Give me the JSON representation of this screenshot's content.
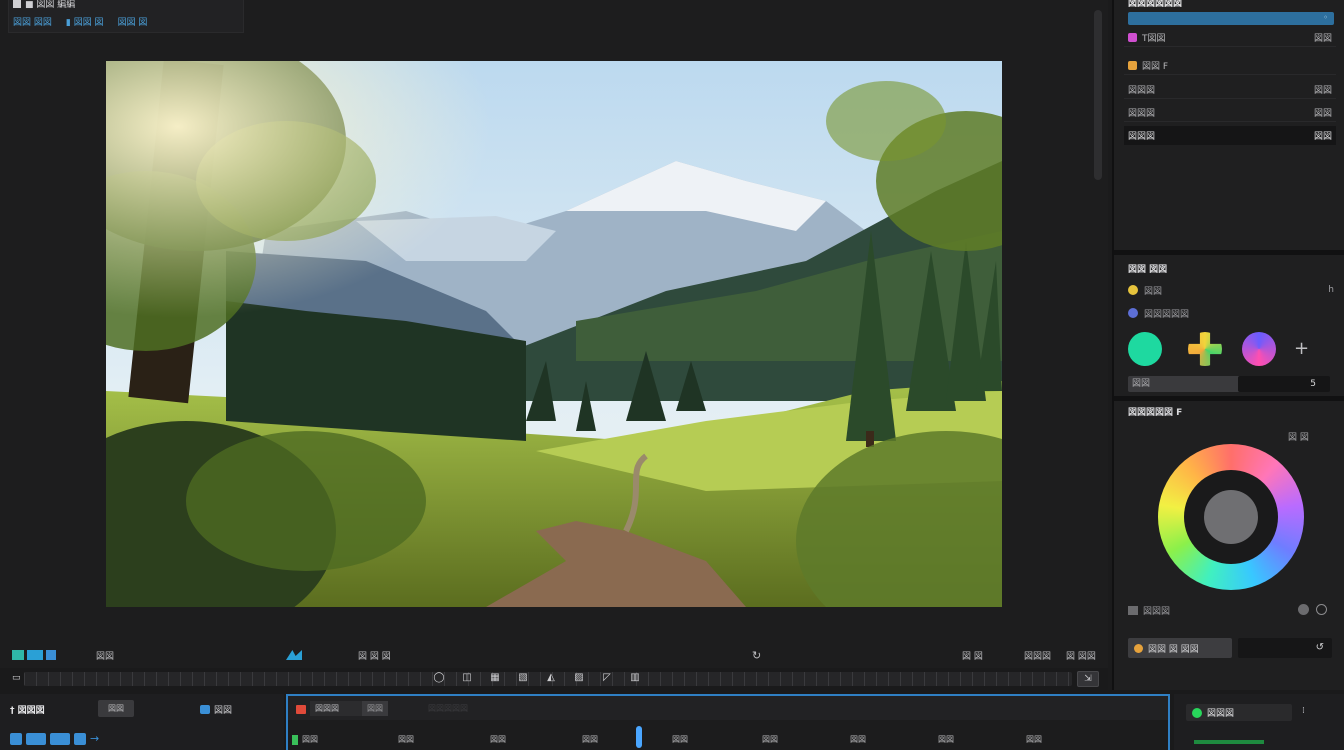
{
  "viewer": {
    "title": "■ 図図 編編",
    "subtitle_items": [
      "図図 図図",
      "▮ 図図 図",
      "図図 図"
    ],
    "toolbar": {
      "left_label": "図図",
      "mid_label": "図 図 図",
      "right_labels": [
        "図 図",
        "図図図",
        "図 図図"
      ]
    },
    "ruler_tools": [
      "◯",
      "◫",
      "▦",
      "▧",
      "◭",
      "▨",
      "◸",
      "▥"
    ],
    "ruler_end": "⇲"
  },
  "inspector": {
    "panel1": {
      "title": "図図図図図図",
      "bar_end": "◦",
      "rows": [
        {
          "label": "T図図",
          "value": "図図",
          "chip": "#d04fd0"
        },
        {
          "label": "図図 F",
          "value": "",
          "chip": "#e6a23c"
        },
        {
          "label": "図図図",
          "value": "図図",
          "chip": ""
        },
        {
          "label": "図図図",
          "value": "図図",
          "chip": ""
        },
        {
          "label": "図図図",
          "value": "図図",
          "chip": "",
          "active": true
        }
      ]
    },
    "panel2": {
      "title": "図図 図図",
      "row1_label": "図図",
      "row1_value": "h",
      "row2_label": "図図図図図",
      "add_glyph": "+",
      "field_label": "図図",
      "field_value": "5"
    },
    "panel3": {
      "title": "図図図図図 F",
      "tools": "図 図",
      "mode_label": "図図図",
      "control_label": "図図 図 図図",
      "control_value": "↺"
    }
  },
  "bottom": {
    "tracks_title": "† 図図図",
    "tracks_button": "図図",
    "tracks_link": "図図",
    "timeline": {
      "name": "図図図",
      "tab": "図図",
      "dim_label": "図図図図図",
      "marks": [
        "図図",
        "図図",
        "図図",
        "図図",
        "図図",
        "図図",
        "図図",
        "図図",
        "図図"
      ]
    },
    "output_label": "図図図",
    "output_end": "⁞"
  },
  "colors": {
    "accent": "#2f7fc4",
    "selection_bar": "#2d6f9e",
    "swatch_1": "#1ed9a0",
    "swatch_2": "#f2a93b",
    "swatch_3": "#6a5cff",
    "status_green": "#28d65b"
  }
}
